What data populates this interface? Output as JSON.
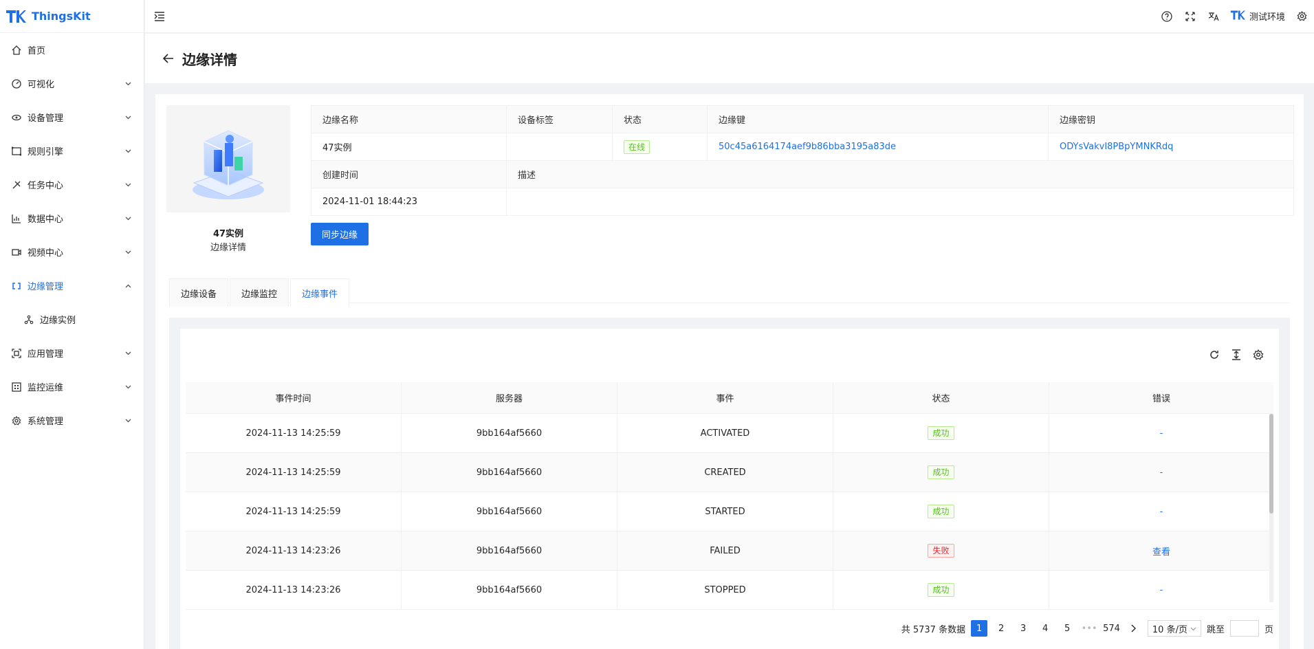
{
  "app": {
    "brand": "ThingsKit",
    "env_label": "测试环境"
  },
  "colors": {
    "primary": "#1f6fe5",
    "success": "#52c41a",
    "error": "#f5222d"
  },
  "sidebar": {
    "items": [
      {
        "label": "首页",
        "icon": "home-icon"
      },
      {
        "label": "可视化",
        "icon": "dashboard-icon"
      },
      {
        "label": "设备管理",
        "icon": "device-icon"
      },
      {
        "label": "规则引擎",
        "icon": "rule-icon"
      },
      {
        "label": "任务中心",
        "icon": "task-icon"
      },
      {
        "label": "数据中心",
        "icon": "chart-icon"
      },
      {
        "label": "视频中心",
        "icon": "video-icon"
      },
      {
        "label": "边缘管理",
        "icon": "edge-icon"
      },
      {
        "label": "边缘实例",
        "icon": "cluster-icon"
      },
      {
        "label": "应用管理",
        "icon": "app-icon"
      },
      {
        "label": "监控运维",
        "icon": "monitor-icon"
      },
      {
        "label": "系统管理",
        "icon": "gear-icon"
      }
    ]
  },
  "page": {
    "title": "边缘详情"
  },
  "instance": {
    "name": "47实例",
    "subtitle": "边缘详情"
  },
  "details": {
    "labels": {
      "name": "边缘名称",
      "tags": "设备标签",
      "status": "状态",
      "key": "边缘键",
      "secret": "边缘密钥",
      "created": "创建时间",
      "desc": "描述"
    },
    "values": {
      "name": "47实例",
      "tags": "",
      "status": "在线",
      "key": "50c45a6164174aef9b86bba3195a83de",
      "secret": "ODYsVakvI8PBpYMNKRdq",
      "created": "2024-11-01 18:44:23",
      "desc": ""
    }
  },
  "sync_button": "同步边缘",
  "tabs": [
    "边缘设备",
    "边缘监控",
    "边缘事件"
  ],
  "table": {
    "headers": [
      "事件时间",
      "服务器",
      "事件",
      "状态",
      "错误"
    ],
    "rows": [
      {
        "time": "2024-11-13 14:25:59",
        "server": "9bb164af5660",
        "event": "ACTIVATED",
        "status": "成功",
        "error": "-"
      },
      {
        "time": "2024-11-13 14:25:59",
        "server": "9bb164af5660",
        "event": "CREATED",
        "status": "成功",
        "error": "-"
      },
      {
        "time": "2024-11-13 14:25:59",
        "server": "9bb164af5660",
        "event": "STARTED",
        "status": "成功",
        "error": "-"
      },
      {
        "time": "2024-11-13 14:23:26",
        "server": "9bb164af5660",
        "event": "FAILED",
        "status": "失败",
        "error": "查看"
      },
      {
        "time": "2024-11-13 14:23:26",
        "server": "9bb164af5660",
        "event": "STOPPED",
        "status": "成功",
        "error": "-"
      }
    ]
  },
  "pagination": {
    "total": "共 5737 条数据",
    "pages": [
      "1",
      "2",
      "3",
      "4",
      "5"
    ],
    "ellipsis": "•••",
    "last": "574",
    "page_size": "10 条/页",
    "jump_label": "跳至",
    "page_unit": "页"
  }
}
